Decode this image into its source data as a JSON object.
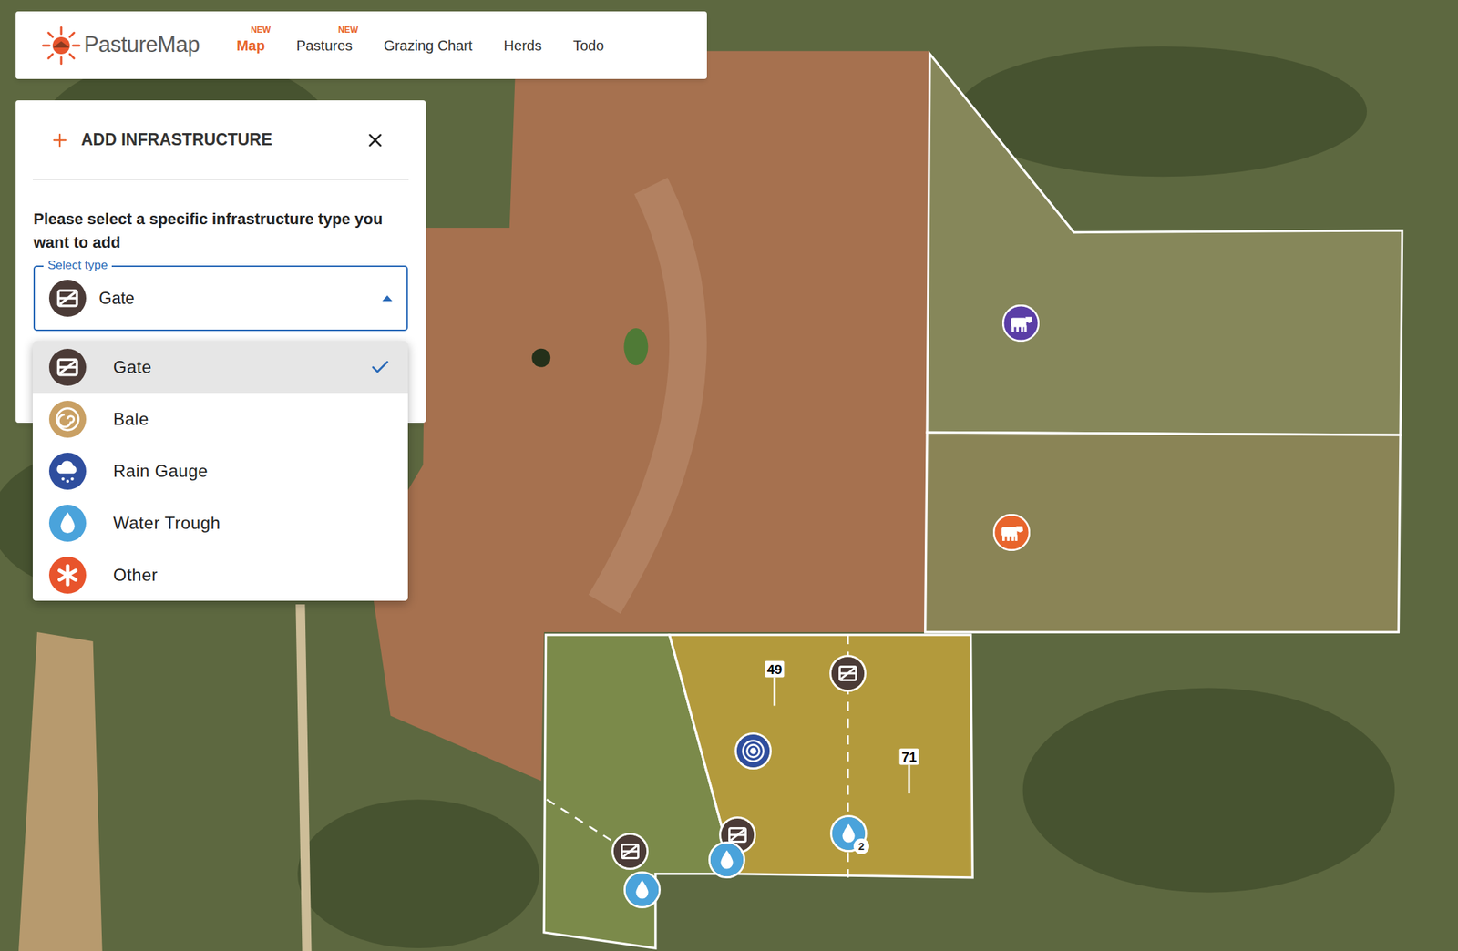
{
  "app": {
    "logo": "PastureMap"
  },
  "nav": [
    {
      "label": "Map",
      "badge": "NEW",
      "selected": true
    },
    {
      "label": "Pastures",
      "badge": "NEW",
      "selected": false
    },
    {
      "label": "Grazing Chart",
      "selected": false
    },
    {
      "label": "Herds",
      "selected": false
    },
    {
      "label": "Todo",
      "selected": false
    }
  ],
  "panel": {
    "title": "ADD INFRASTRUCTURE",
    "prompt": "Please select a specific infrastructure type you want to add",
    "select": {
      "label": "Select type",
      "value": "Gate",
      "kind": "gate",
      "expanded": true
    },
    "options": [
      {
        "label": "Gate",
        "kind": "gate",
        "selected": true
      },
      {
        "label": "Bale",
        "kind": "bale",
        "selected": false
      },
      {
        "label": "Rain Gauge",
        "kind": "rain",
        "selected": false
      },
      {
        "label": "Water Trough",
        "kind": "water",
        "selected": false
      },
      {
        "label": "Other",
        "kind": "other",
        "selected": false
      }
    ]
  },
  "map": {
    "pins": [
      {
        "kind": "herd",
        "color": "#5b3ea6"
      },
      {
        "kind": "herd",
        "color": "#e8652d"
      },
      {
        "kind": "gate"
      },
      {
        "kind": "gate"
      },
      {
        "kind": "gate"
      },
      {
        "kind": "target"
      },
      {
        "kind": "water",
        "count": "2"
      },
      {
        "kind": "water"
      },
      {
        "kind": "water"
      },
      {
        "kind": "label",
        "text": "49"
      },
      {
        "kind": "label",
        "text": "71"
      }
    ]
  }
}
